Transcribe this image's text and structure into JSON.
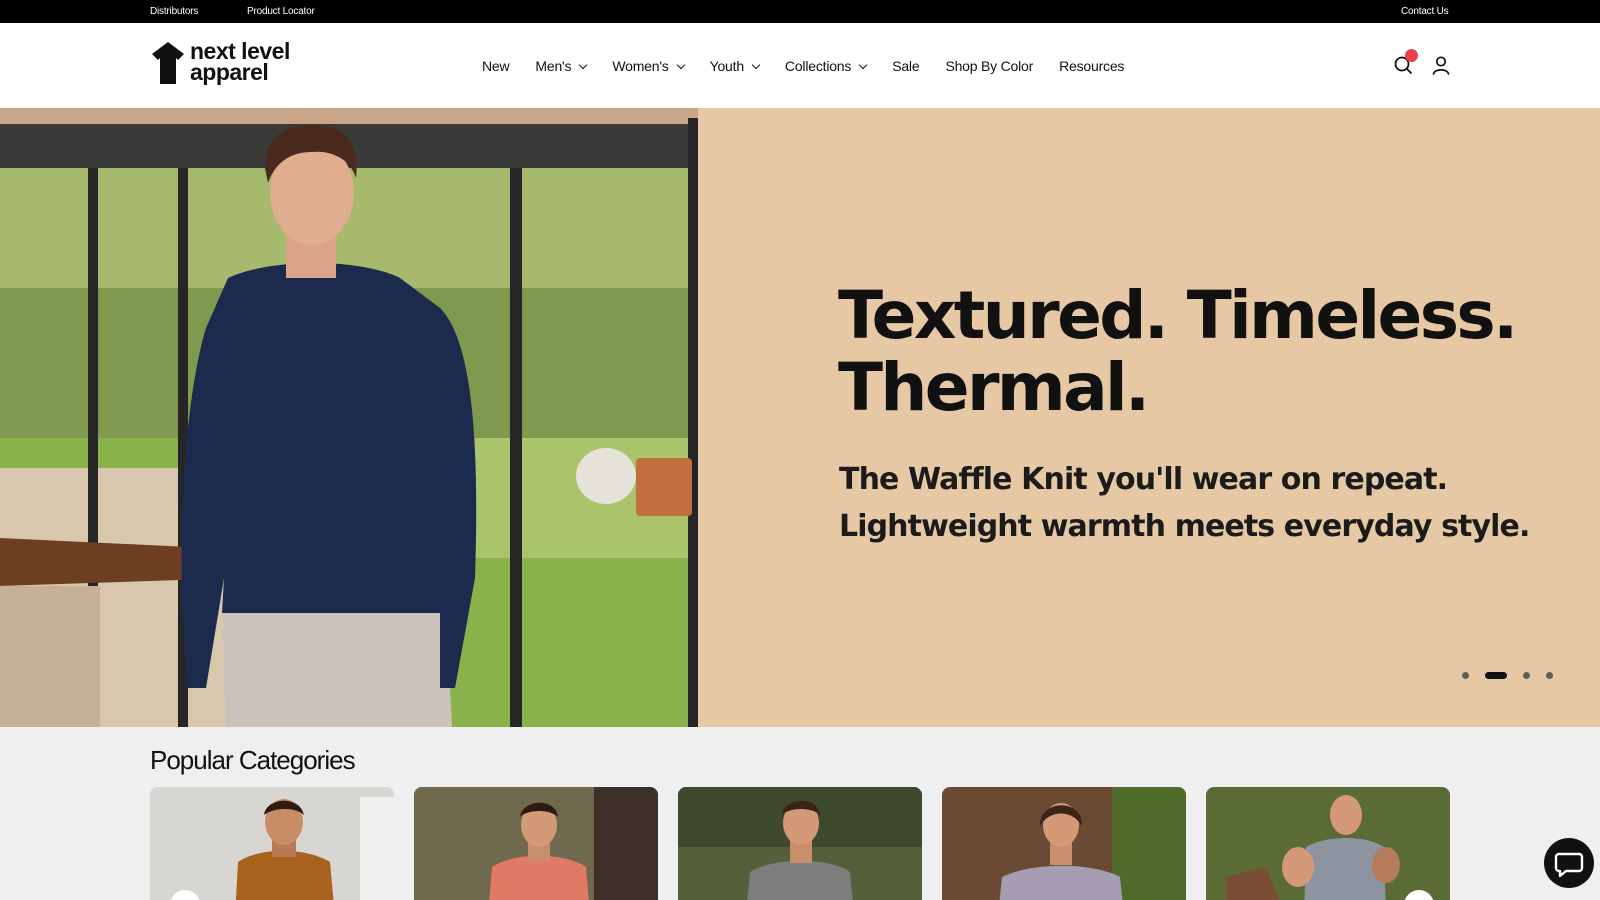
{
  "topbar": {
    "distributors": "Distributors",
    "product_locator": "Product Locator",
    "contact_us": "Contact Us"
  },
  "header": {
    "logo_line1": "next level",
    "logo_line2": "apparel",
    "nav": [
      {
        "label": "New",
        "has_dropdown": false
      },
      {
        "label": "Men's",
        "has_dropdown": true
      },
      {
        "label": "Women's",
        "has_dropdown": true
      },
      {
        "label": "Youth",
        "has_dropdown": true
      },
      {
        "label": "Collections",
        "has_dropdown": true
      },
      {
        "label": "Sale",
        "has_dropdown": false
      },
      {
        "label": "Shop By Color",
        "has_dropdown": false
      },
      {
        "label": "Resources",
        "has_dropdown": false
      }
    ],
    "icons": [
      "search-icon",
      "account-icon"
    ],
    "notification_color": "#e8404e"
  },
  "hero": {
    "headline_line1": "Textured. Timeless.",
    "headline_line2": "Thermal.",
    "sub_line1": "The Waffle Knit you'll wear on repeat.",
    "sub_line2": "Lightweight warmth meets everyday style.",
    "background_color": "#e7c8a4",
    "slide_count": 4,
    "active_slide": 2
  },
  "popular": {
    "title": "Popular Categories",
    "cards": 5
  },
  "chat": {
    "icon": "chat-icon"
  }
}
